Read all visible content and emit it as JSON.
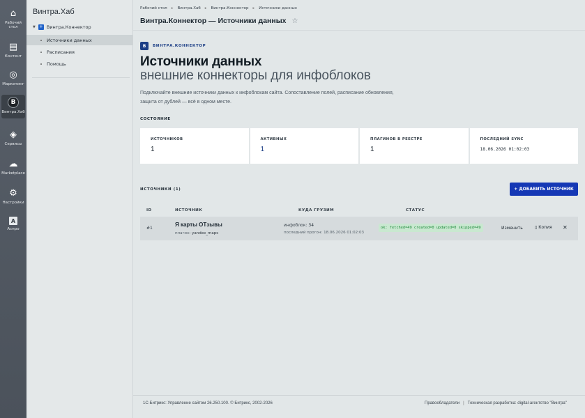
{
  "rail": [
    {
      "label": "Рабочий\nстол",
      "icon": "home-icon",
      "glyph": "⌂"
    },
    {
      "label": "Контент",
      "icon": "document-icon",
      "glyph": "▤"
    },
    {
      "label": "Маркетинг",
      "icon": "target-icon",
      "glyph": "◎"
    },
    {
      "label": "Винтра.Хаб",
      "icon": "vintra-logo-icon",
      "glyph": "В"
    },
    {
      "label": "Сервисы",
      "icon": "layers-icon",
      "glyph": "◈"
    },
    {
      "label": "Marketplace",
      "icon": "cloud-download-icon",
      "glyph": "☁"
    },
    {
      "label": "Настройки",
      "icon": "gear-icon",
      "glyph": "⚙"
    },
    {
      "label": "Aспро",
      "icon": "aspro-icon",
      "glyph": "A"
    }
  ],
  "menu": {
    "title": "Винтра.Хаб",
    "root": "Винтра.Коннектор",
    "items": [
      "Источники данных",
      "Расписания",
      "Помощь"
    ]
  },
  "breadcrumbs": [
    "Рабочий стол",
    "Винтра.Хаб",
    "Винтра.Коннектор",
    "Источники данных"
  ],
  "page_title": "Винтра.Коннектор — Источники данных",
  "brand": {
    "logo": "В",
    "name": "ВИНТРА.КОННЕКТОР"
  },
  "hero": {
    "title": "Источники данных",
    "subtitle": "внешние коннекторы для инфоблоков",
    "description": "Подключайте внешние источники данных к инфоблокам сайта. Сопоставление полей, расписание обновления, защита от дублей — всё в одном месте."
  },
  "state_label": "СОСТОЯНИЕ",
  "stats": [
    {
      "key": "ИСТОЧНИКОВ",
      "value": "1"
    },
    {
      "key": "АКТИВНЫХ",
      "value": "1"
    },
    {
      "key": "ПЛАГИНОВ В РЕЕСТРЕ",
      "value": "1"
    },
    {
      "key": "ПОСЛЕДНИЙ SYNC",
      "value": "18.06.2026 01:02:03"
    }
  ],
  "sources_label": "ИСТОЧНИКИ (1)",
  "add_button": "+ ДОБАВИТЬ ИСТОЧНИК",
  "table": {
    "headers": [
      "ID",
      "ИСТОЧНИК",
      "КУДА ГРУЗИМ",
      "СТАТУС"
    ],
    "rows": [
      {
        "id": "#1",
        "name": "Я карты ОТзывы",
        "plugin_label": "плагин:",
        "plugin": "yandex_maps",
        "iblock_label": "инфоблок:",
        "iblock": "34",
        "last_run": "последний прогон: 18.06.2026 01:02:03",
        "status": "ok: fetched=49 created=0 updated=0 skipped=49",
        "edit": "Изменить",
        "copy": "Копия",
        "delete": "✕"
      }
    ]
  },
  "footer": {
    "left": "1С-Битрикс: Управление сайтом 26.250.100. © Битрикс, 2002-2026",
    "right_1": "Правообладатели",
    "right_sep": "|",
    "right_2": "Техническая разработка: digital-агентство \"Винтра\""
  },
  "colors": {
    "accent": "#1538b5",
    "brand": "#1d3f86",
    "status_ok": "#1e8a3c"
  }
}
